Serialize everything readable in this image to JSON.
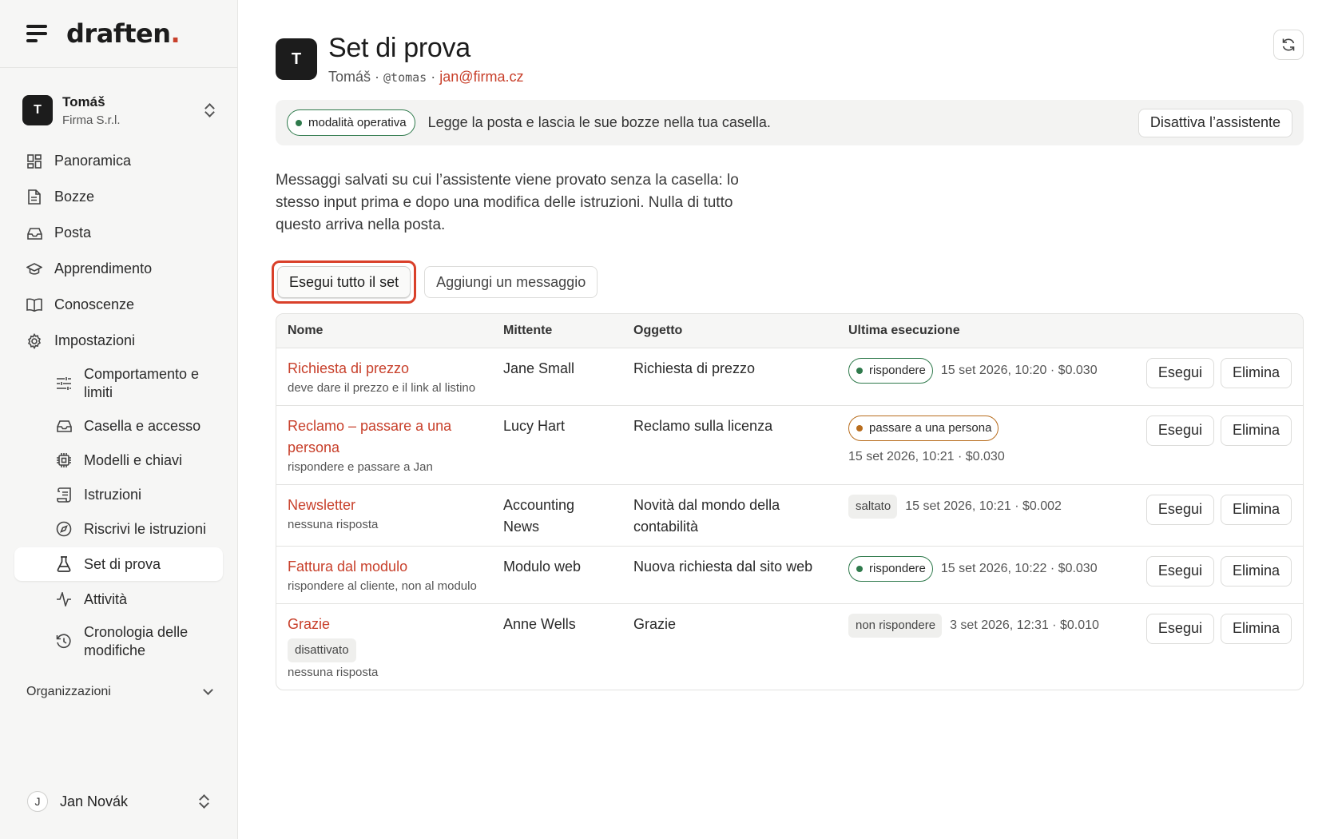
{
  "brand": {
    "name": "draften",
    "dot": "."
  },
  "account": {
    "initial": "T",
    "name": "Tomáš",
    "company": "Firma S.r.l."
  },
  "nav": {
    "overview": "Panoramica",
    "drafts": "Bozze",
    "mail": "Posta",
    "learning": "Apprendimento",
    "knowledge": "Conoscenze",
    "settings": "Impostazioni",
    "sub": {
      "behavior": "Comportamento e limiti",
      "mailbox": "Casella e accesso",
      "models": "Modelli e chiavi",
      "instructions": "Istruzioni",
      "rewrite": "Riscrivi le istruzioni",
      "testset": "Set di prova",
      "activity": "Attività",
      "history": "Cronologia delle modifiche"
    },
    "organizations": "Organizzazioni"
  },
  "user": {
    "initial": "J",
    "name": "Jan Novák"
  },
  "page": {
    "initial": "T",
    "title": "Set di prova",
    "owner": "Tomáš",
    "sep1": " · ",
    "handle": "@tomas",
    "sep2": " · ",
    "email": "jan@firma.cz"
  },
  "mode": {
    "badge": "modalità operativa",
    "description": "Legge la posta e lascia le sue bozze nella tua casella.",
    "disable_button": "Disattiva l’assistente"
  },
  "intro": "Messaggi salvati su cui l’assistente viene provato senza la casella: lo stesso input prima e dopo una modifica delle istruzioni. Nulla di tutto questo arriva nella posta.",
  "actions": {
    "run_all": "Esegui tutto il set",
    "add_message": "Aggiungi un messaggio"
  },
  "table": {
    "headers": {
      "name": "Nome",
      "sender": "Mittente",
      "subject": "Oggetto",
      "last_run": "Ultima esecuzione"
    },
    "run_label": "Esegui",
    "delete_label": "Elimina",
    "rows": [
      {
        "name": "Richiesta di prezzo",
        "hint": "deve dare il prezzo e il link al listino",
        "sender": "Jane Small",
        "subject": "Richiesta di prezzo",
        "status": "rispondere",
        "meta": "15 set 2026, 10:20 · $0.030"
      },
      {
        "name": "Reclamo – passare a una persona",
        "hint": "rispondere e passare a Jan",
        "sender": "Lucy Hart",
        "subject": "Reclamo sulla licenza",
        "status": "passare a una persona",
        "meta": "15 set 2026, 10:21 · $0.030"
      },
      {
        "name": "Newsletter",
        "hint": "nessuna risposta",
        "sender": "Accounting News",
        "subject": "Novità dal mondo della contabilità",
        "status": "saltato",
        "meta": "15 set 2026, 10:21 · $0.002"
      },
      {
        "name": "Fattura dal modulo",
        "hint": "rispondere al cliente, non al modulo",
        "sender": "Modulo web",
        "subject": "Nuova richiesta dal sito web",
        "status": "rispondere",
        "meta": "15 set 2026, 10:22 · $0.030"
      },
      {
        "name": "Grazie",
        "tag": "disattivato",
        "hint": "nessuna risposta",
        "sender": "Anne Wells",
        "subject": "Grazie",
        "status": "non rispondere",
        "meta": "3 set 2026, 12:31 · $0.010"
      }
    ]
  },
  "colors": {
    "accent": "#c8402b",
    "green": "#2f7a4c",
    "orange": "#b86d1e",
    "focus_ring": "#d9402a"
  }
}
